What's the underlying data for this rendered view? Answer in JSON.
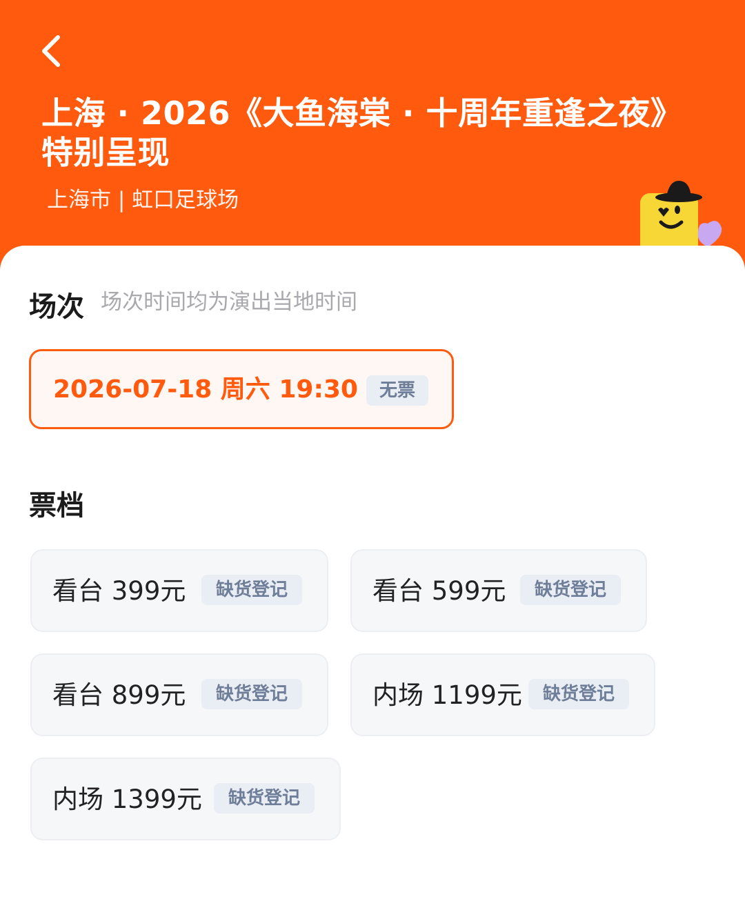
{
  "header": {
    "title_line1": "上海 · 2026《大鱼海棠 · 十周年重逢之夜》",
    "title_line2": "特别呈现",
    "venue": "上海市 | 虹口足球场"
  },
  "session": {
    "title": "场次",
    "hint": "场次时间均为演出当地时间",
    "items": [
      {
        "label": "2026-07-18  周六 19:30",
        "tag": "无票"
      }
    ]
  },
  "tiers": {
    "title": "票档",
    "items": [
      {
        "label": "看台 399元",
        "tag": "缺货登记"
      },
      {
        "label": "看台 599元",
        "tag": "缺货登记"
      },
      {
        "label": "看台 899元",
        "tag": "缺货登记"
      },
      {
        "label": "内场 1199元",
        "tag": "缺货登记"
      },
      {
        "label": "内场 1399元",
        "tag": "缺货登记"
      }
    ]
  },
  "colors": {
    "brand": "#ff5a0d",
    "tag_bg": "#e9edf4",
    "tag_text": "#6f7e98"
  },
  "icons": {
    "back": "chevron-left-icon",
    "mascot": "mascot-sticker-icon"
  }
}
